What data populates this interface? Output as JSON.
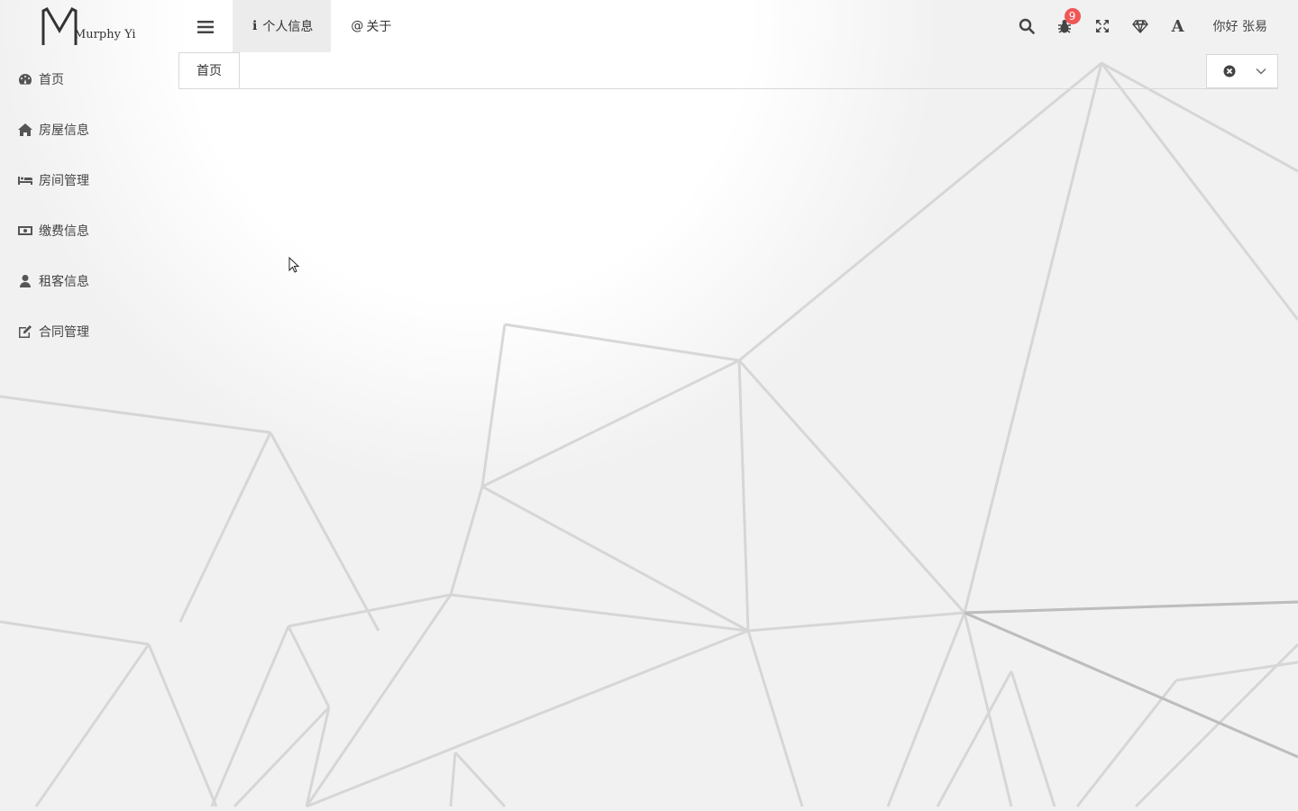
{
  "app": {
    "logo_text": "Murphy Yi"
  },
  "sidebar": {
    "items": [
      {
        "label": "首页",
        "icon": "dashboard-icon"
      },
      {
        "label": "房屋信息",
        "icon": "home-icon"
      },
      {
        "label": "房间管理",
        "icon": "bed-icon"
      },
      {
        "label": "缴费信息",
        "icon": "money-icon"
      },
      {
        "label": "租客信息",
        "icon": "user-icon"
      },
      {
        "label": "合同管理",
        "icon": "edit-icon"
      }
    ]
  },
  "topbar": {
    "nav": [
      {
        "glyph": "ℹ",
        "label": "个人信息",
        "active": true
      },
      {
        "glyph": "@",
        "label": "关于",
        "active": false
      }
    ],
    "notifications_count": "9",
    "greeting": "你好 张易"
  },
  "tabs": {
    "items": [
      {
        "label": "首页"
      }
    ]
  },
  "colors": {
    "badge": "#f05656",
    "background": "#f1f1f1"
  }
}
